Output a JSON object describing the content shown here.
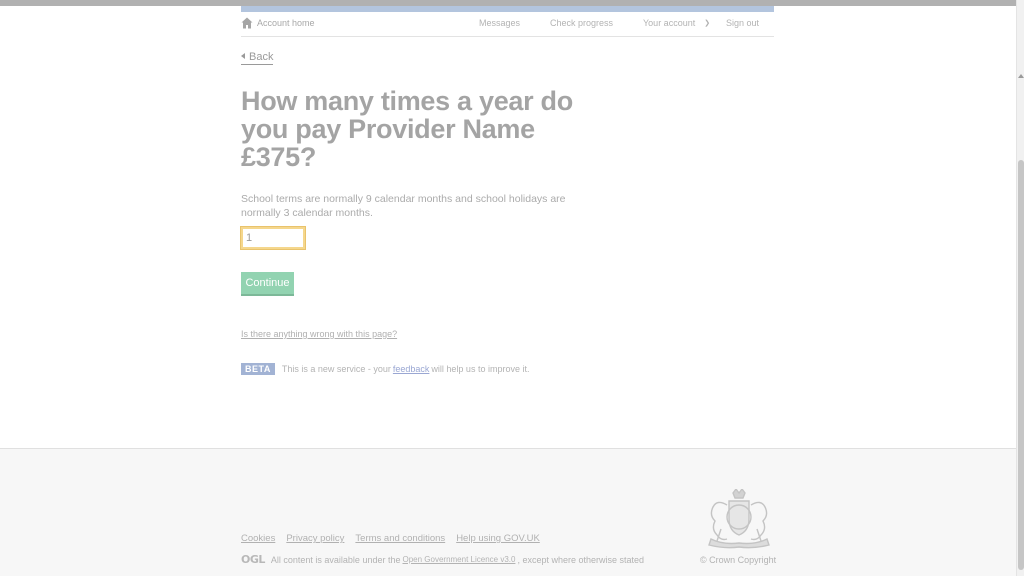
{
  "nav": {
    "home_label": "Account home",
    "messages_label": "Messages",
    "check_progress_label": "Check progress",
    "your_account_label": "Your account",
    "sign_out_label": "Sign out"
  },
  "back_label": "Back",
  "question": {
    "title": "How many times a year do you pay Provider Name £375?",
    "hint": "School terms are normally 9 calendar months and school holidays are normally 3 calendar months.",
    "input_value": "1"
  },
  "continue_label": "Continue",
  "report_link": "Is there anything wrong with this page?",
  "beta": {
    "tag": "BETA",
    "text_before": "This is a new service - your",
    "feedback_link": "feedback",
    "text_after": "will help us to improve it."
  },
  "footer": {
    "links": [
      "Cookies",
      "Privacy policy",
      "Terms and conditions",
      "Help using GOV.UK"
    ],
    "ogl_logo": "OGL",
    "licence_before": "All content is available under the",
    "licence_link": "Open Government Licence v3.0",
    "licence_after": ", except where otherwise stated",
    "copyright": "© Crown Copyright"
  },
  "colors": {
    "button_green": "#92d3b1",
    "beta_tag": "#a2b3d4",
    "focus_yellow": "#f5d78d",
    "nav_strip": "#b3c5de"
  },
  "icons": {
    "home": "home-icon",
    "chevron": "chevron-down-icon",
    "back": "triangle-left-icon",
    "crest": "royal-coat-of-arms-icon"
  }
}
